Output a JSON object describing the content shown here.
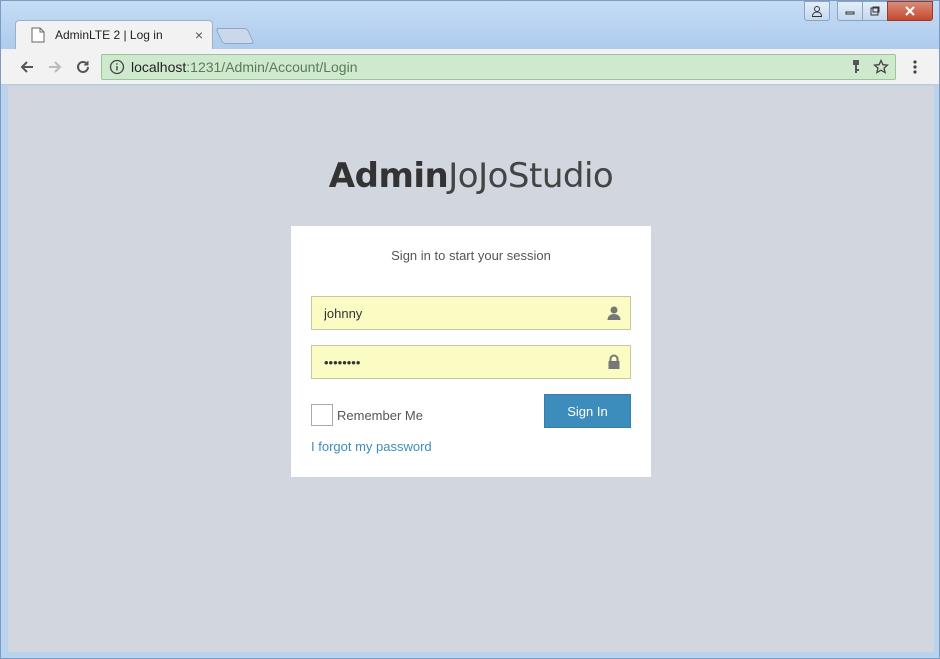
{
  "browser": {
    "tab_title": "AdminLTE 2 | Log in",
    "tab_close": "×",
    "url_host": "localhost",
    "url_path": ":1231/Admin/Account/Login"
  },
  "page": {
    "logo_bold": "Admin",
    "logo_light": "JoJoStudio",
    "login_message": "Sign in to start your session",
    "username_value": "johnny",
    "password_value": "••••••••",
    "remember_label": "Remember Me",
    "signin_label": "Sign In",
    "forgot_label": "I forgot my password"
  },
  "colors": {
    "page_bg": "#d2d6de",
    "primary": "#3c8dbc",
    "autofill": "#fafcc4",
    "omnibox_secure": "#cfe9cf"
  }
}
